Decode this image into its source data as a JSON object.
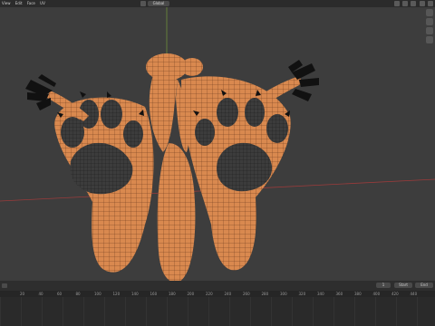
{
  "header": {
    "menus": [
      "View",
      "Edit",
      "Face",
      "UV"
    ],
    "mode_label": "Global"
  },
  "timeline": {
    "ruler_ticks": [
      "20",
      "40",
      "60",
      "80",
      "100",
      "120",
      "140",
      "160",
      "180",
      "200",
      "220",
      "240",
      "260",
      "280",
      "300",
      "320",
      "340",
      "360",
      "380",
      "400",
      "420",
      "440"
    ],
    "playback_buttons": [
      "|◀",
      "◀◀",
      "◀",
      "▶",
      "▶▶",
      "▶|"
    ],
    "current_frame": "1",
    "start_label": "Start",
    "end_label": "End"
  },
  "colors": {
    "skin": "#d9894f",
    "pad": "#3a3a3a",
    "claw": "#111111",
    "wire": "#222222"
  }
}
